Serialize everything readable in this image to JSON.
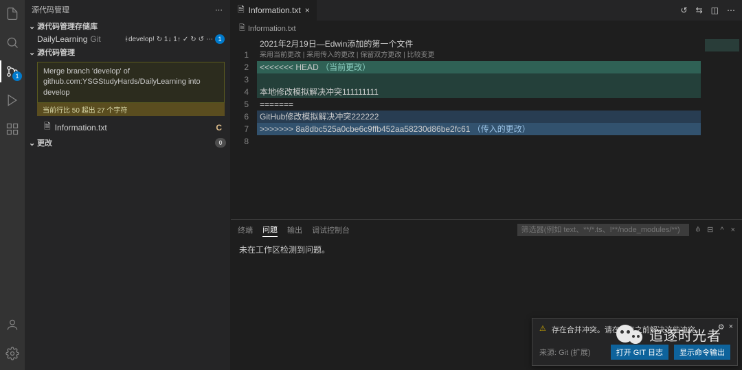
{
  "activityBar": {
    "scmBadge": "1"
  },
  "sidebar": {
    "title": "源代码管理",
    "repoSection": "源代码管理存储库",
    "repoName": "DailyLearning",
    "repoVcs": "Git",
    "branchLabel": "develop!",
    "syncIndicator": "↻ 1↓ 1↑",
    "scmSection": "源代码管理",
    "mergeMsg": "Merge branch 'develop' of github.com:YSGStudyHards/DailyLearning into develop",
    "mergeWarn": "当前行比 50 超出 27 个字符",
    "mergeFile": "Information.txt",
    "mergeFileStatus": "C",
    "changesSection": "更改",
    "changesCount": "0"
  },
  "tab": {
    "fileName": "Information.txt"
  },
  "breadcrumb": {
    "file": "Information.txt"
  },
  "codelens": {
    "accept_current": "采用当前更改",
    "accept_incoming": "采用传入的更改",
    "accept_both": "保留双方更改",
    "compare": "比较变更"
  },
  "editor": {
    "lines": [
      "1",
      "2",
      "3",
      "4",
      "5",
      "6",
      "7",
      "8"
    ],
    "l1": "2021年2月19日—Edwin添加的第一个文件",
    "l2a": "<<<<<<< HEAD",
    "l2b": "（当前更改）",
    "l3": "",
    "l4": "本地修改模拟解决冲突111111111",
    "l5": "=======",
    "l6": "GitHub修改模拟解决冲突222222",
    "l7a": ">>>>>>> 8a8dbc525a0cbe6c9ffb452aa58230d86be2fc61",
    "l7b": "（传入的更改）"
  },
  "panel": {
    "tab_terminal": "终端",
    "tab_problems": "问题",
    "tab_output": "输出",
    "tab_debug": "调试控制台",
    "filter_placeholder": "筛选器(例如 text、**/*.ts、!**/node_modules/**)",
    "body": "未在工作区检测到问题。"
  },
  "notification": {
    "message": "存在合并冲突。请在提交之前解决这些冲突。",
    "source": "来源: Git (扩展)",
    "btn_log": "打开 GIT 日志",
    "btn_output": "显示命令输出"
  },
  "watermark": {
    "text": "追逐时光者"
  }
}
